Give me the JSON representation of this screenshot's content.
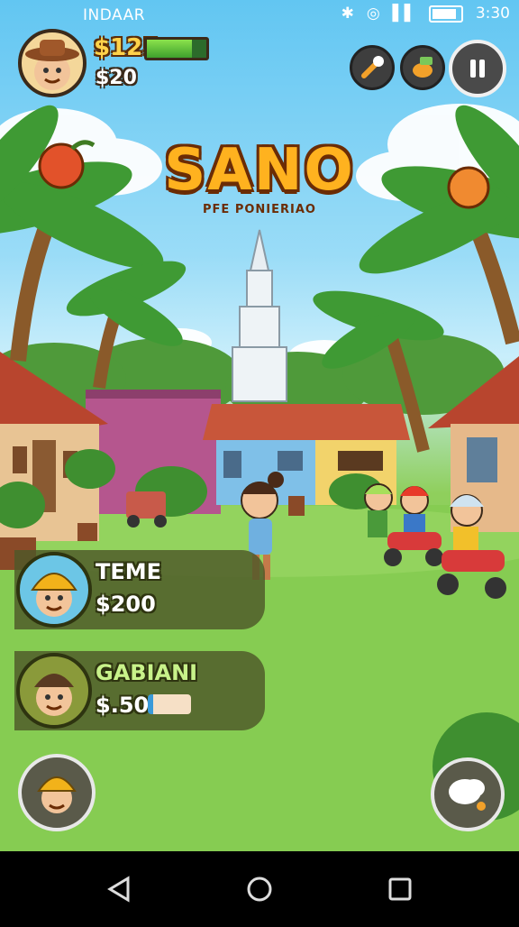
{
  "status_bar": {
    "carrier": "INDAAR",
    "time": "3:30",
    "icons": [
      "bluetooth-icon",
      "sync-icon",
      "signal-icon",
      "battery-icon"
    ]
  },
  "player": {
    "money": "$125",
    "energy_fraction": 0.75,
    "sub_value": "$20"
  },
  "top_actions": [
    "wrench-icon",
    "hand-money-icon",
    "pause-icon"
  ],
  "game_title": "SANO",
  "game_subtitle": "PFE PONIERIAO",
  "cards": [
    {
      "name": "TEME",
      "value": "$200",
      "avatar": "worker-helmet-avatar"
    },
    {
      "name": "GABIANI",
      "value": "$.50",
      "avatar": "farmer-avatar"
    }
  ],
  "bottom_actions": [
    "builder-avatar-button",
    "cloud-action-button"
  ],
  "nav": [
    "back-icon",
    "home-icon",
    "recents-icon"
  ],
  "colors": {
    "sky": "#62c6f2",
    "grass": "#7fc84b",
    "title": "#ffb21f",
    "panel": "#4e5828"
  }
}
